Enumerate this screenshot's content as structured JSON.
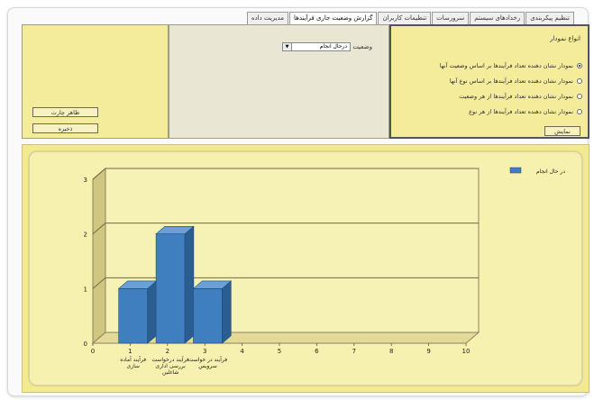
{
  "tabs": [
    {
      "label": "مدیریت داده",
      "active": false
    },
    {
      "label": "گزارش وضعیت جاری فرآیندها",
      "active": true
    },
    {
      "label": "تنظیمات کاربران",
      "active": false
    },
    {
      "label": "سرورسات",
      "active": false
    },
    {
      "label": "رخدادهای سیستم",
      "active": false
    },
    {
      "label": "تنظیم پیکربندی",
      "active": false
    }
  ],
  "left_panel": {
    "show_chart_button": "ظاهر چارت",
    "save_button": "ذخیره"
  },
  "middle_panel": {
    "status_label": "وضعیت",
    "status_select_value": "درحال انجام"
  },
  "right_panel": {
    "title": "انواع نمودار",
    "options": [
      {
        "label": "نمودار نشان دهنده تعداد فرآیندها بر اساس وضعیت آنها",
        "checked": true
      },
      {
        "label": "نمودار نشان دهنده تعداد فرآیندها بر اساس نوع آنها",
        "checked": false
      },
      {
        "label": "نمودار نشان دهنده تعداد فرآیندها از هر وضعیت",
        "checked": false
      },
      {
        "label": "نمودار نشان دهنده تعداد فرآیندها از هر نوع",
        "checked": false
      }
    ],
    "show_button": "نمایش"
  },
  "chart_data": {
    "type": "bar",
    "categories": [
      "فرآیند آماده سازی",
      "فرآیند درخواست بررسی اداری شاغلین",
      "فرآیند در خواست سرویس"
    ],
    "values": [
      1,
      2,
      1
    ],
    "series": [
      {
        "name": "در حال انجام",
        "values": [
          1,
          2,
          1
        ]
      }
    ],
    "x_ticks": [
      "0",
      "1",
      "2",
      "3",
      "4",
      "5",
      "6",
      "7",
      "8",
      "9",
      "10"
    ],
    "y_ticks": [
      "0",
      "1",
      "2",
      "3"
    ],
    "ylim": [
      0,
      3
    ],
    "xlim": [
      0,
      10
    ],
    "grid": true,
    "legend_position": "top-right",
    "colors": {
      "bar": "#3f7fc0",
      "bar_dark": "#2a5e92",
      "bar_top": "#6aa0d6",
      "plot_bg": "#f6f1b4"
    }
  }
}
